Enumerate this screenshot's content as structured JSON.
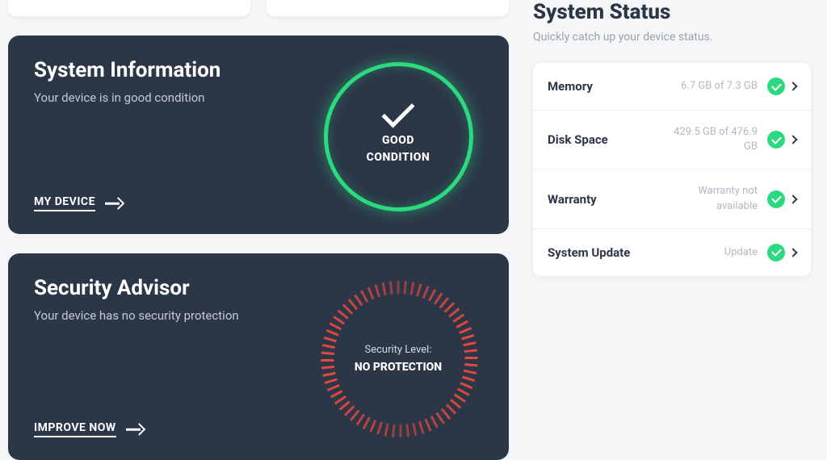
{
  "system_info": {
    "title": "System Information",
    "subtitle": "Your device is in good condition",
    "cta": "MY DEVICE",
    "gauge_label": "GOOD\nCONDITION"
  },
  "security": {
    "title": "Security Advisor",
    "subtitle": "Your device has no security protection",
    "cta": "IMPROVE NOW",
    "gauge_label1": "Security Level:",
    "gauge_label2": "NO PROTECTION"
  },
  "status": {
    "title": "System Status",
    "subtitle": "Quickly catch up your device status.",
    "rows": [
      {
        "label": "Memory",
        "value": "6.7 GB of 7.3 GB"
      },
      {
        "label": "Disk Space",
        "value": "429.5 GB of 476.9 GB"
      },
      {
        "label": "Warranty",
        "value": "Warranty not available"
      },
      {
        "label": "System Update",
        "value": "Update"
      }
    ]
  }
}
